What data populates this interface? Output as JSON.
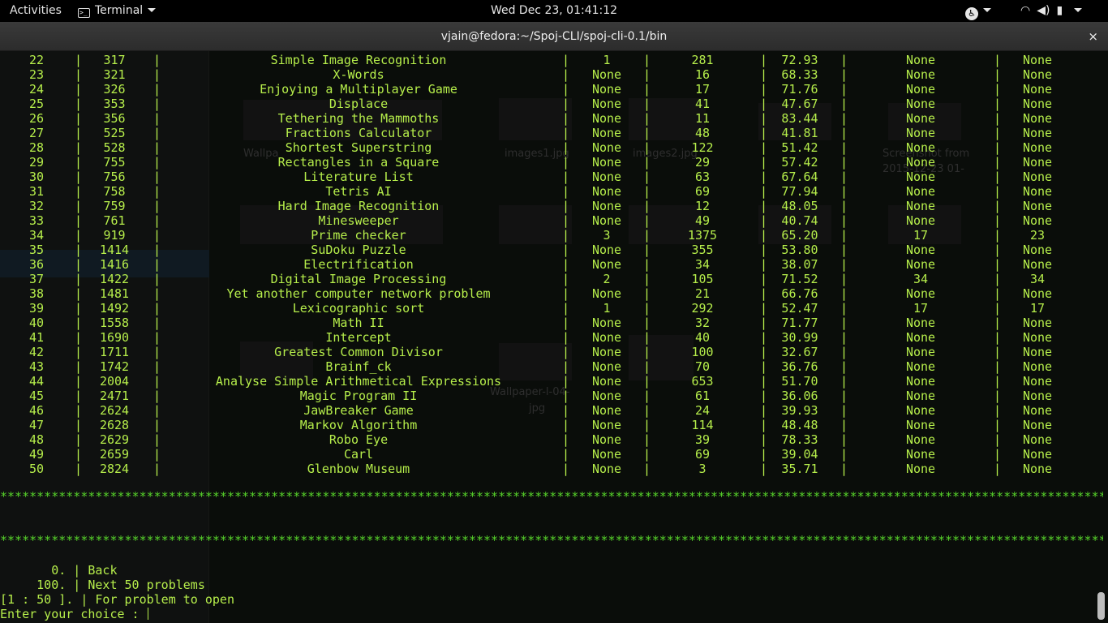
{
  "topbar": {
    "activities": "Activities",
    "app_name": "Terminal",
    "clock": "Wed Dec 23, 01:41:12",
    "icons": [
      "accessibility-icon",
      "wifi-icon",
      "volume-icon",
      "battery-icon"
    ]
  },
  "window": {
    "title": "vjain@fedora:~/Spoj-CLI/spoj-cli-0.1/bin",
    "close_glyph": "×"
  },
  "colors": {
    "terminal_text": "#b6ee4b",
    "stars": "#58d52b",
    "background": "#0a0d0a"
  },
  "table": {
    "rows": [
      [
        "22",
        "317",
        "Simple Image Recognition",
        "1",
        "281",
        "72.93",
        "None",
        "None"
      ],
      [
        "23",
        "321",
        "X-Words",
        "None",
        "16",
        "68.33",
        "None",
        "None"
      ],
      [
        "24",
        "326",
        "Enjoying a Multiplayer Game",
        "None",
        "17",
        "71.76",
        "None",
        "None"
      ],
      [
        "25",
        "353",
        "Displace",
        "None",
        "41",
        "47.67",
        "None",
        "None"
      ],
      [
        "26",
        "356",
        "Tethering the Mammoths",
        "None",
        "11",
        "83.44",
        "None",
        "None"
      ],
      [
        "27",
        "525",
        "Fractions Calculator",
        "None",
        "48",
        "41.81",
        "None",
        "None"
      ],
      [
        "28",
        "528",
        "Shortest Superstring",
        "None",
        "122",
        "51.42",
        "None",
        "None"
      ],
      [
        "29",
        "755",
        "Rectangles in a Square",
        "None",
        "29",
        "57.42",
        "None",
        "None"
      ],
      [
        "30",
        "756",
        "Literature List",
        "None",
        "63",
        "67.64",
        "None",
        "None"
      ],
      [
        "31",
        "758",
        "Tetris AI",
        "None",
        "69",
        "77.94",
        "None",
        "None"
      ],
      [
        "32",
        "759",
        "Hard Image Recognition",
        "None",
        "12",
        "48.05",
        "None",
        "None"
      ],
      [
        "33",
        "761",
        "Minesweeper",
        "None",
        "49",
        "40.74",
        "None",
        "None"
      ],
      [
        "34",
        "919",
        "Prime checker",
        "3",
        "1375",
        "65.20",
        "17",
        "23"
      ],
      [
        "35",
        "1414",
        "SuDoku Puzzle",
        "None",
        "355",
        "53.80",
        "None",
        "None"
      ],
      [
        "36",
        "1416",
        "Electrification",
        "None",
        "34",
        "38.07",
        "None",
        "None"
      ],
      [
        "37",
        "1422",
        "Digital Image Processing",
        "2",
        "105",
        "71.52",
        "34",
        "34"
      ],
      [
        "38",
        "1481",
        "Yet another computer network problem",
        "None",
        "21",
        "66.76",
        "None",
        "None"
      ],
      [
        "39",
        "1492",
        "Lexicographic sort",
        "1",
        "292",
        "52.47",
        "17",
        "17"
      ],
      [
        "40",
        "1558",
        "Math II",
        "None",
        "32",
        "71.77",
        "None",
        "None"
      ],
      [
        "41",
        "1690",
        "Intercept",
        "None",
        "40",
        "30.99",
        "None",
        "None"
      ],
      [
        "42",
        "1711",
        "Greatest Common Divisor",
        "None",
        "100",
        "32.67",
        "None",
        "None"
      ],
      [
        "43",
        "1742",
        "Brainf_ck",
        "None",
        "70",
        "36.76",
        "None",
        "None"
      ],
      [
        "44",
        "2004",
        "Analyse Simple Arithmetical Expressions",
        "None",
        "653",
        "51.70",
        "None",
        "None"
      ],
      [
        "45",
        "2471",
        "Magic Program II",
        "None",
        "61",
        "36.06",
        "None",
        "None"
      ],
      [
        "46",
        "2624",
        "JawBreaker Game",
        "None",
        "24",
        "39.93",
        "None",
        "None"
      ],
      [
        "47",
        "2628",
        "Markov Algorithm",
        "None",
        "114",
        "48.48",
        "None",
        "None"
      ],
      [
        "48",
        "2629",
        "Robo Eye",
        "None",
        "39",
        "78.33",
        "None",
        "None"
      ],
      [
        "49",
        "2659",
        "Carl",
        "None",
        "69",
        "39.04",
        "None",
        "None"
      ],
      [
        "50",
        "2824",
        "Glenbow Museum",
        "None",
        "3",
        "35.71",
        "None",
        "None"
      ]
    ]
  },
  "separator_char": "|",
  "star_line": "**************************************************************************************************************************************************************************************",
  "menu": {
    "options": [
      "       0. | Back",
      "     100. | Next 50 problems",
      "[1 : 50 ]. | For problem to open"
    ],
    "prompt": "Enter your choice : "
  },
  "background_ghost_labels": [
    "Wallpa",
    "images1.jpg",
    "images2.jpg",
    "Screenshot from",
    "2015-12-23 01-",
    "Wallpaper-l-04-",
    "jpg"
  ]
}
